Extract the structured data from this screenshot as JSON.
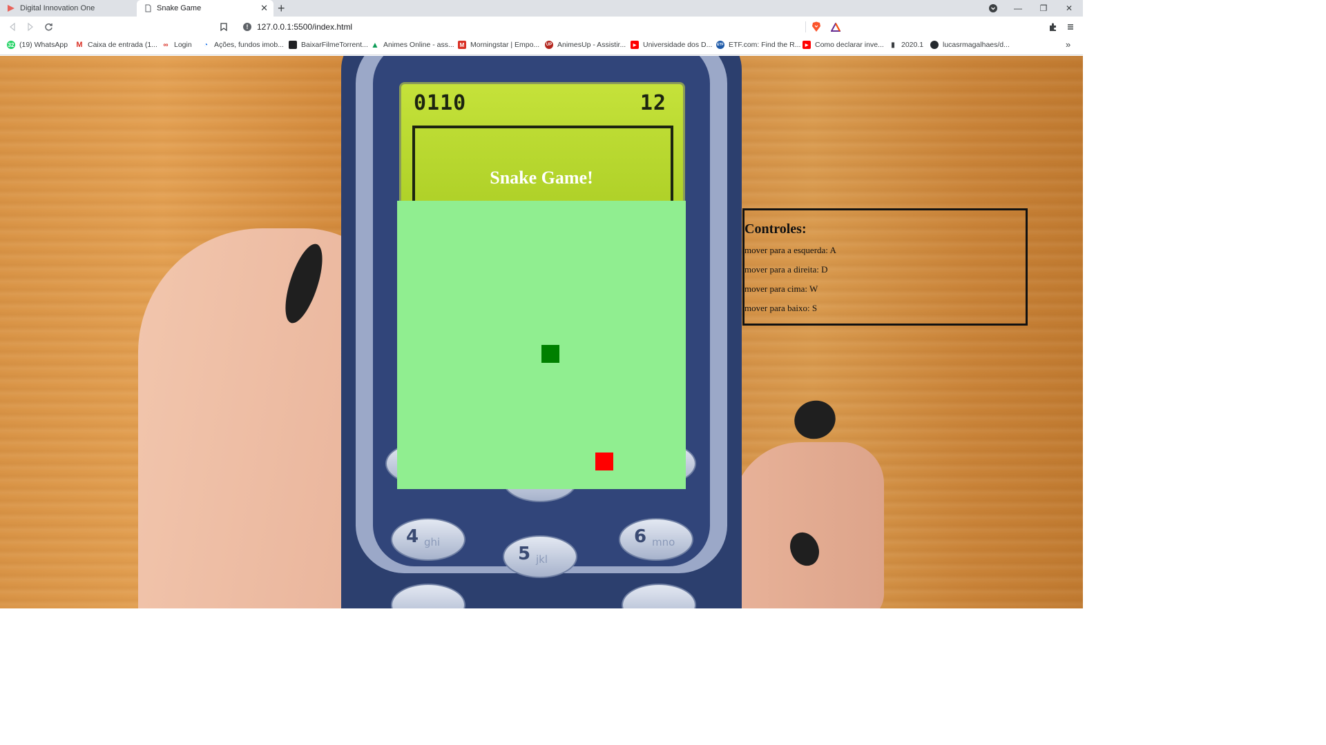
{
  "browser": {
    "tabs": [
      {
        "label": "Digital Innovation One",
        "active": false
      },
      {
        "label": "Snake Game",
        "active": true
      }
    ],
    "url": "127.0.0.1:5500/index.html",
    "bookmarks": [
      {
        "label": "(19) WhatsApp",
        "icon": "whatsapp-icon"
      },
      {
        "label": "Caixa de entrada (1...",
        "icon": "gmail-icon"
      },
      {
        "label": "Login",
        "icon": "login-icon"
      },
      {
        "label": "Ações, fundos imob...",
        "icon": "funds-icon"
      },
      {
        "label": "BaixarFilmeTorrent...",
        "icon": "film-icon"
      },
      {
        "label": "Animes Online - ass...",
        "icon": "anime-icon"
      },
      {
        "label": "Morningstar | Empo...",
        "icon": "morningstar-icon"
      },
      {
        "label": "AnimesUp - Assistir...",
        "icon": "animesup-icon"
      },
      {
        "label": "Universidade dos D...",
        "icon": "youtube-icon"
      },
      {
        "label": "ETF.com: Find the R...",
        "icon": "etf-icon"
      },
      {
        "label": "Como declarar inve...",
        "icon": "youtube-icon"
      },
      {
        "label": "2020.1",
        "icon": "file-icon"
      },
      {
        "label": "lucasrmagalhaes/d...",
        "icon": "github-icon"
      }
    ],
    "bookmarks_overflow": "»"
  },
  "game": {
    "title": "Snake Game!",
    "background_lcd": {
      "score": "0110",
      "level": "12"
    },
    "snake_color": "#008000",
    "food_color": "#ff0000",
    "board_color": "#90ee90"
  },
  "controls": {
    "heading": "Controles:",
    "items": [
      "mover para a esquerda: A",
      "mover para a direita: D",
      "mover para cima: W",
      "mover para baixo: S"
    ]
  },
  "phone_keys": [
    {
      "num": "4",
      "letters": "ghi"
    },
    {
      "num": "5",
      "letters": "jkl"
    },
    {
      "num": "6",
      "letters": "mno"
    }
  ]
}
